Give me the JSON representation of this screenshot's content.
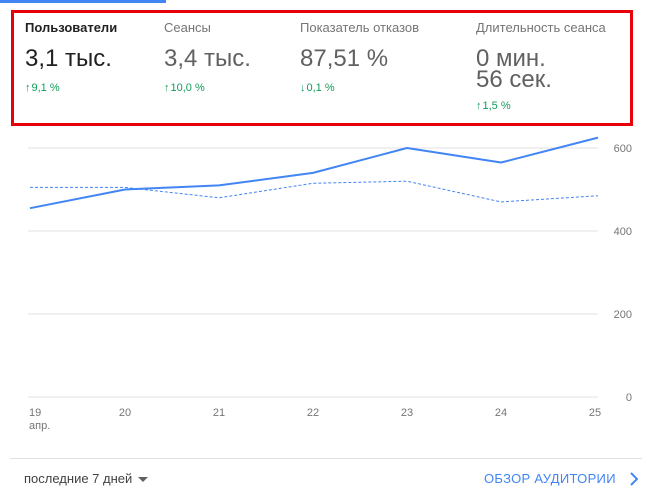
{
  "metrics": [
    {
      "label": "Пользователи",
      "value": "3,1 тыс.",
      "value2": "",
      "change_arrow": "↑",
      "change": "9,1 %",
      "active": true
    },
    {
      "label": "Сеансы",
      "value": "3,4 тыс.",
      "value2": "",
      "change_arrow": "↑",
      "change": "10,0 %",
      "active": false
    },
    {
      "label": "Показатель отказов",
      "value": "87,51 %",
      "value2": "",
      "change_arrow": "↓",
      "change": "0,1 %",
      "active": false
    },
    {
      "label": "Длительность сеанса",
      "value": "0 мин.",
      "value2": "56 сек.",
      "change_arrow": "↑",
      "change": "1,5 %",
      "active": false
    }
  ],
  "chart_data": {
    "type": "line",
    "categories": [
      "19",
      "20",
      "21",
      "22",
      "23",
      "24",
      "25"
    ],
    "x_sublabel": "апр.",
    "y_ticks": [
      "600",
      "400",
      "200",
      "0"
    ],
    "ylim": [
      0,
      600
    ],
    "series": [
      {
        "values": [
          455,
          500,
          510,
          540,
          600,
          565,
          625
        ],
        "color": "#4285f4",
        "style": "solid"
      },
      {
        "values": [
          505,
          505,
          480,
          515,
          520,
          470,
          485
        ],
        "color": "#4285f4",
        "style": "dashed"
      }
    ],
    "grid": true
  },
  "footer": {
    "date_range": "последние 7 дней",
    "audience_link": "ОБЗОР АУДИТОРИИ"
  },
  "colors": {
    "accent": "#4285f4",
    "positive": "#0f9d58",
    "highlight_border": "#e8000b"
  }
}
